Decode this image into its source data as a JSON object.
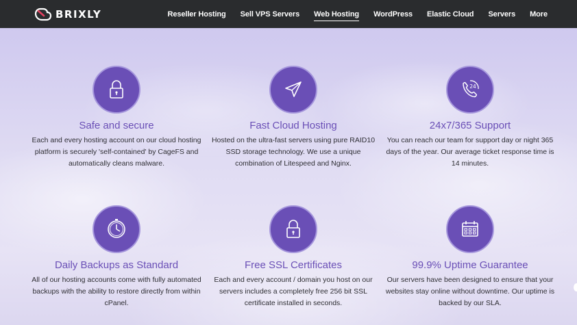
{
  "header": {
    "logo_text": "BRIXLY",
    "nav": [
      {
        "label": "Reseller Hosting"
      },
      {
        "label": "Sell VPS Servers"
      },
      {
        "label": "Web Hosting",
        "active": true
      },
      {
        "label": "WordPress"
      },
      {
        "label": "Elastic Cloud"
      },
      {
        "label": "Servers"
      },
      {
        "label": "More"
      }
    ]
  },
  "features": [
    {
      "icon": "lock-icon",
      "title": "Safe and secure",
      "text": "Each and every hosting account on our cloud hosting platform is securely 'self-contained' by CageFS and automatically cleans malware."
    },
    {
      "icon": "paper-plane-icon",
      "title": "Fast Cloud Hosting",
      "text": "Hosted on the ultra-fast servers using pure RAID10 SSD storage technology. We use a unique combination of Litespeed and Nginx."
    },
    {
      "icon": "phone-24-icon",
      "title": "24x7/365 Support",
      "text": "You can reach our team for support day or night 365 days of the year. Our average ticket response time is 14 minutes."
    },
    {
      "icon": "clock-icon",
      "title": "Daily Backups as Standard",
      "text": "All of our hosting accounts come with fully automated backups with the ability to restore directly from within cPanel."
    },
    {
      "icon": "lock-icon",
      "title": "Free SSL Certificates",
      "text": "Each and every account / domain you host on our servers includes a completely free 256 bit SSL certificate installed in seconds."
    },
    {
      "icon": "calendar-icon",
      "title": "99.9% Uptime Guarantee",
      "text": "Our servers have been designed to ensure that your websites stay online without downtime. Our uptime is backed by our SLA."
    }
  ],
  "colors": {
    "accent": "#6a4fb6",
    "topbar": "#2a2c2e"
  }
}
